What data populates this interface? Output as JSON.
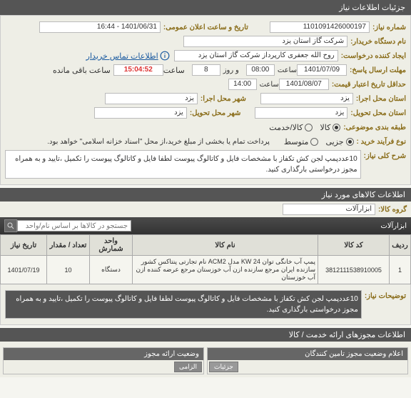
{
  "header": {
    "title": "جزئیات اطلاعات نیاز"
  },
  "fields": {
    "req_no_label": "شماره نیاز:",
    "req_no": "1101091426000197",
    "announce_label": "تاریخ و ساعت اعلان عمومی:",
    "announce": "1401/06/31 - 16:44",
    "buyer_label": "نام دستگاه خریدار:",
    "buyer": "شرکت گاز استان یزد",
    "requester_label": "ایجاد کننده درخواست:",
    "requester": "روح الله جعفری کارپرداز شرکت گاز استان یزد",
    "contact_link": "اطلاعات تماس خریدار",
    "deadline_label": "مهلت ارسال پاسخ:",
    "deadline_date": "1401/07/09",
    "time_label": "ساعت",
    "deadline_time": "08:00",
    "days_label": "و روز",
    "days_value": "8",
    "countdown": "15:04:52",
    "remain_label": "ساعت باقی مانده",
    "validity_label": "حداقل تاریخ اعتبار قیمت:",
    "validity_date": "1401/08/07",
    "validity_time": "14:00",
    "province_exec_label": "استان محل اجرا:",
    "province_exec": "یزد",
    "city_exec_label": "شهر محل اجرا:",
    "city_exec": "یزد",
    "province_deliv_label": "استان محل تحویل:",
    "province_deliv": "یزد",
    "city_deliv_label": "شهر محل تحویل:",
    "city_deliv": "یزد",
    "req_type_label": "طبقه بندی موضوعی:",
    "opt_goods": "کالا",
    "opt_service": "کالا/خدمت",
    "buy_proc_label": "نوع فرآیند خرید :",
    "opt_partial": "جزیی",
    "opt_medium": "متوسط",
    "buy_note": "پرداخت تمام یا بخشی از مبلغ خرید،از محل \"اسناد خزانه اسلامی\" خواهد بود.",
    "main_desc_label": "شرح کلی نیاز:",
    "main_desc": "10عددپمپ لجن کش تکفاز با مشخصات فایل و کاتالوگ پیوست لطفا فایل و کاتالوگ پیوست را تکمیل ،تایید و به همراه مجوز درخواستی بارگذاری کنید."
  },
  "goods_section": {
    "title": "اطلاعات کالاهای مورد نیاز"
  },
  "group": {
    "label": "گروه کالا:",
    "value": "ابزارآلات"
  },
  "items_bar": {
    "label": "ابزارآلات",
    "search_placeholder": "جستجو در کالاها بر اساس نام/واحد"
  },
  "table": {
    "headers": {
      "row": "ردیف",
      "code": "کد کالا",
      "name": "نام کالا",
      "unit": "واحد شمارش",
      "qty": "تعداد / مقدار",
      "date": "تاریخ نیاز"
    },
    "rows": [
      {
        "row": "1",
        "code": "3812111538910005",
        "name": "پمپ آب خانگی توان KW 24 مدل ACM2 نام تجارتی پنتاکس کشور سازنده ایران مرجع سازنده ازن آب خوزستان مرجع عرضه کننده ازن آب خوزستان",
        "unit": "دستگاه",
        "qty": "10",
        "date": "1401/07/19"
      }
    ]
  },
  "extra_desc": {
    "label": "توضیحات نیاز:",
    "text": "10عددپمپ لجن کش تکفاز با مشخصات فایل و کاتالوگ پیوست لطفا فایل و کاتالوگ پیوست را تکمیل ،تایید و به همراه مجوز درخواستی بارگذاری کنید."
  },
  "permits_section": {
    "title": "اطلاعات مجوزهای ارائه خدمت / کالا"
  },
  "sub1": {
    "title": "اعلام وضعیت مجوز تامین کنندگان",
    "btn": "جزئیات"
  },
  "sub2": {
    "title": "وضعیت ارائه مجوز",
    "label": "الزامی"
  }
}
